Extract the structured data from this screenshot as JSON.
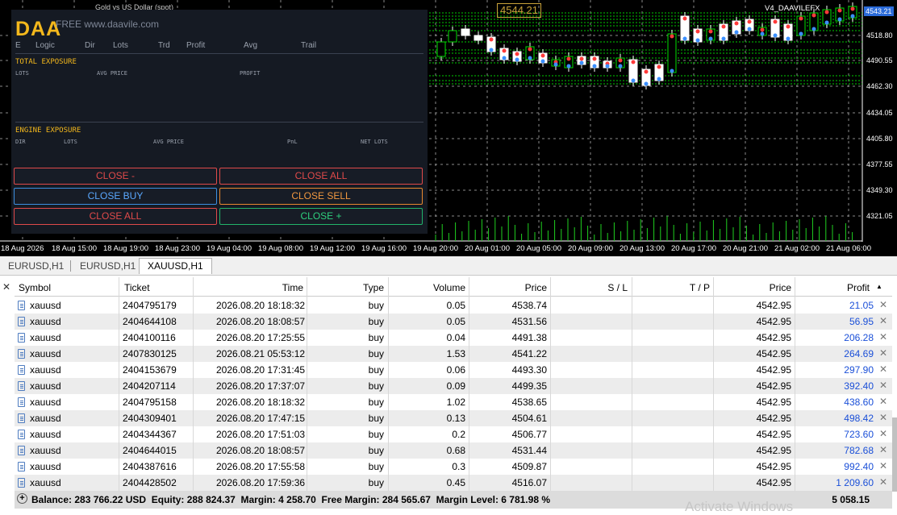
{
  "chart": {
    "window_title": "Gold vs US Dollar (spot)",
    "ea_label": "V4_DAAVILEFX",
    "current_price": "4543.21",
    "highlight_price": "4544.21",
    "price_labels": [
      "4518.80",
      "4490.55",
      "4462.30",
      "4434.05",
      "4405.80",
      "4377.55",
      "4349.30",
      "4321.05"
    ],
    "time_labels": [
      "18 Aug 2026",
      "18 Aug 15:00",
      "18 Aug 19:00",
      "18 Aug 23:00",
      "19 Aug 04:00",
      "19 Aug 08:00",
      "19 Aug 12:00",
      "19 Aug 16:00",
      "19 Aug 20:00",
      "20 Aug 01:00",
      "20 Aug 05:00",
      "20 Aug 09:00",
      "20 Aug 13:00",
      "20 Aug 17:00",
      "20 Aug 21:00",
      "21 Aug 02:00",
      "21 Aug 06:00"
    ],
    "colors": {
      "bull_outline": "#00e000",
      "bear_fill": "#ffffff",
      "grid": "#8a8a8a",
      "level_lines": "#00cc00"
    }
  },
  "panel": {
    "logo": "DAA",
    "watermark": "FREE www.daavile.com",
    "headers": [
      "E",
      "Logic",
      "Dir",
      "Lots",
      "Trd",
      "Profit",
      "Avg",
      "Trail"
    ],
    "total_exposure": {
      "title": "TOTAL EXPOSURE",
      "cols": [
        "LOTS",
        "AVG PRICE",
        "PROFIT"
      ]
    },
    "engine_exposure": {
      "title": "ENGINE EXPOSURE",
      "cols": [
        "DIR",
        "LOTS",
        "AVG PRICE",
        "PnL",
        "NET LOTS"
      ]
    },
    "buttons": {
      "close_minus": "CLOSE -",
      "close_all_top": "CLOSE ALL",
      "close_buy": "CLOSE BUY",
      "close_sell": "CLOSE SELL",
      "close_all_bottom": "CLOSE ALL",
      "close_plus": "CLOSE +"
    },
    "colors": {
      "accent": "#f4b81c",
      "red": "#e04a4a",
      "blue": "#3c8fe0",
      "orange": "#e8892f",
      "green": "#22b46b"
    }
  },
  "tabs": [
    "EURUSD,H1",
    "EURUSD,H1",
    "XAUUSD,H1"
  ],
  "terminal": {
    "columns": {
      "symbol": "Symbol",
      "ticket": "Ticket",
      "time": "Time",
      "type": "Type",
      "volume": "Volume",
      "price": "Price",
      "sl": "S / L",
      "tp": "T / P",
      "price2": "Price",
      "profit": "Profit"
    },
    "rows": [
      {
        "symbol": "xauusd",
        "ticket": "2404795179",
        "time": "2026.08.20 18:18:32",
        "type": "buy",
        "volume": "0.05",
        "price": "4538.74",
        "sl": "",
        "tp": "",
        "cur": "4542.95",
        "profit": "21.05"
      },
      {
        "symbol": "xauusd",
        "ticket": "2404644108",
        "time": "2026.08.20 18:08:57",
        "type": "buy",
        "volume": "0.05",
        "price": "4531.56",
        "sl": "",
        "tp": "",
        "cur": "4542.95",
        "profit": "56.95"
      },
      {
        "symbol": "xauusd",
        "ticket": "2404100116",
        "time": "2026.08.20 17:25:55",
        "type": "buy",
        "volume": "0.04",
        "price": "4491.38",
        "sl": "",
        "tp": "",
        "cur": "4542.95",
        "profit": "206.28"
      },
      {
        "symbol": "xauusd",
        "ticket": "2407830125",
        "time": "2026.08.21 05:53:12",
        "type": "buy",
        "volume": "1.53",
        "price": "4541.22",
        "sl": "",
        "tp": "",
        "cur": "4542.95",
        "profit": "264.69"
      },
      {
        "symbol": "xauusd",
        "ticket": "2404153679",
        "time": "2026.08.20 17:31:45",
        "type": "buy",
        "volume": "0.06",
        "price": "4493.30",
        "sl": "",
        "tp": "",
        "cur": "4542.95",
        "profit": "297.90"
      },
      {
        "symbol": "xauusd",
        "ticket": "2404207114",
        "time": "2026.08.20 17:37:07",
        "type": "buy",
        "volume": "0.09",
        "price": "4499.35",
        "sl": "",
        "tp": "",
        "cur": "4542.95",
        "profit": "392.40"
      },
      {
        "symbol": "xauusd",
        "ticket": "2404795158",
        "time": "2026.08.20 18:18:32",
        "type": "buy",
        "volume": "1.02",
        "price": "4538.65",
        "sl": "",
        "tp": "",
        "cur": "4542.95",
        "profit": "438.60"
      },
      {
        "symbol": "xauusd",
        "ticket": "2404309401",
        "time": "2026.08.20 17:47:15",
        "type": "buy",
        "volume": "0.13",
        "price": "4504.61",
        "sl": "",
        "tp": "",
        "cur": "4542.95",
        "profit": "498.42"
      },
      {
        "symbol": "xauusd",
        "ticket": "2404344367",
        "time": "2026.08.20 17:51:03",
        "type": "buy",
        "volume": "0.2",
        "price": "4506.77",
        "sl": "",
        "tp": "",
        "cur": "4542.95",
        "profit": "723.60"
      },
      {
        "symbol": "xauusd",
        "ticket": "2404644015",
        "time": "2026.08.20 18:08:57",
        "type": "buy",
        "volume": "0.68",
        "price": "4531.44",
        "sl": "",
        "tp": "",
        "cur": "4542.95",
        "profit": "782.68"
      },
      {
        "symbol": "xauusd",
        "ticket": "2404387616",
        "time": "2026.08.20 17:55:58",
        "type": "buy",
        "volume": "0.3",
        "price": "4509.87",
        "sl": "",
        "tp": "",
        "cur": "4542.95",
        "profit": "992.40"
      },
      {
        "symbol": "xauusd",
        "ticket": "2404428502",
        "time": "2026.08.20 17:59:36",
        "type": "buy",
        "volume": "0.45",
        "price": "4516.07",
        "sl": "",
        "tp": "",
        "cur": "4542.95",
        "profit": "1 209.60"
      }
    ],
    "summary": "Balance: 283 766.22 USD  Equity: 288 824.37  Margin: 4 258.70  Free Margin: 284 565.67  Margin Level: 6 781.98 %",
    "total_profit": "5 058.15",
    "profit_color": "#1a4fd8"
  },
  "watermark": "Activate Windows"
}
